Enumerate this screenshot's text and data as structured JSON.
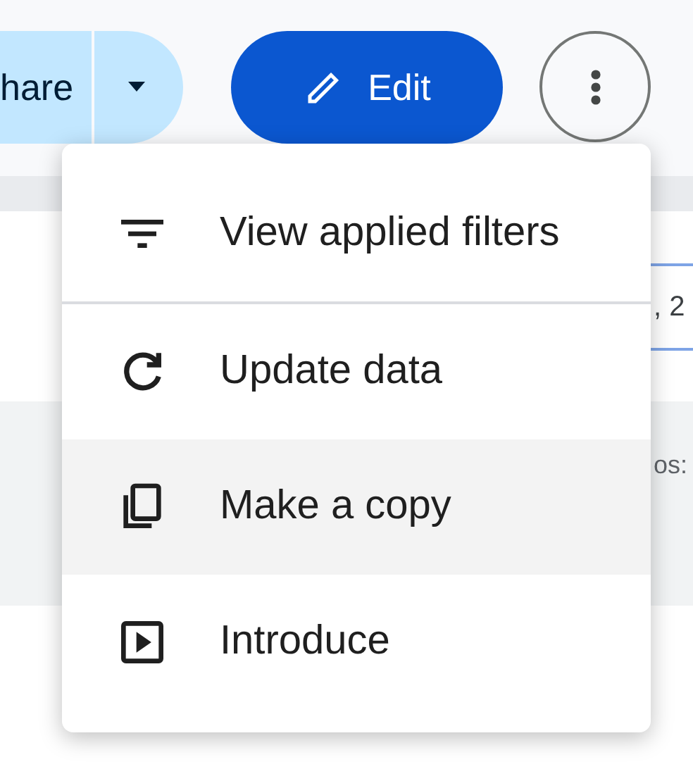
{
  "toolbar": {
    "share_button": {
      "label": "hare"
    },
    "edit_button": {
      "label": "Edit"
    }
  },
  "background": {
    "field_value": ", 2",
    "row_text": "os:"
  },
  "menu": {
    "items": [
      {
        "kind": "filter",
        "label": "View applied filters",
        "highlighted": false,
        "divider_after": true
      },
      {
        "kind": "refresh",
        "label": "Update data",
        "highlighted": false,
        "divider_after": false
      },
      {
        "kind": "copy",
        "label": "Make a copy",
        "highlighted": true,
        "divider_after": false
      },
      {
        "kind": "present",
        "label": "Introduce",
        "highlighted": false,
        "divider_after": false
      }
    ]
  }
}
